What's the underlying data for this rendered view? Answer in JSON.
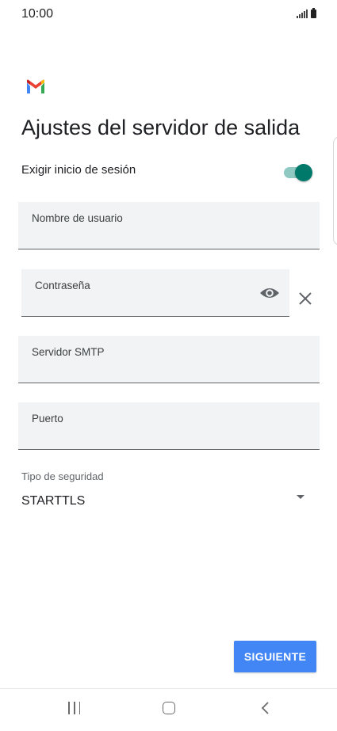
{
  "status_bar": {
    "time": "10:00"
  },
  "header": {
    "title": "Ajustes del servidor de salida"
  },
  "login_toggle": {
    "label": "Exigir inicio de sesión",
    "enabled": true
  },
  "fields": {
    "username": {
      "label": "Nombre de usuario",
      "value": ""
    },
    "password": {
      "label": "Contraseña",
      "value": ""
    },
    "smtp_server": {
      "label": "Servidor SMTP",
      "value": ""
    },
    "port": {
      "label": "Puerto",
      "value": ""
    }
  },
  "security": {
    "label": "Tipo de seguridad",
    "selected": "STARTTLS"
  },
  "actions": {
    "next_label": "SIGUIENTE"
  },
  "colors": {
    "accent": "#00796b",
    "button": "#4285f4",
    "field_bg": "#f1f3f4"
  },
  "icons": [
    "signal-icon",
    "battery-icon",
    "gmail-logo",
    "eye-icon",
    "close-icon",
    "dropdown-arrow-icon",
    "recent-apps-icon",
    "home-icon",
    "back-icon"
  ]
}
